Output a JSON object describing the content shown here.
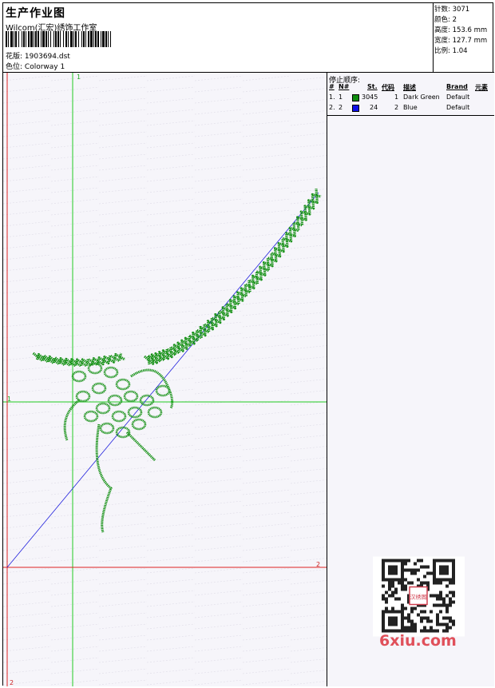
{
  "header": {
    "title": "生产作业图",
    "company": "Wilcom(汇宏)绣饰工作室",
    "design": {
      "label": "花版:",
      "value": "1903694.dst"
    },
    "colorway": {
      "label": "色位:",
      "value": "Colorway 1"
    }
  },
  "stats": [
    {
      "label": "针数:",
      "value": "3071"
    },
    {
      "label": "颜色:",
      "value": "2"
    },
    {
      "label": "高度:",
      "value": "153.6 mm"
    },
    {
      "label": "宽度:",
      "value": "127.7 mm"
    },
    {
      "label": "比例:",
      "value": "1.04"
    }
  ],
  "stop_sequence": {
    "title": "停止顺序:",
    "headers": {
      "hash": "#",
      "n": "N#",
      "st": "St.",
      "code": "代码",
      "desc": "描述",
      "brand": "Brand",
      "elements": "元素"
    },
    "rows": [
      {
        "hash": "1.",
        "n": "1",
        "color": "#0f8c0f",
        "st": "3045",
        "code": "1",
        "desc": "Dark Green",
        "brand": "Default"
      },
      {
        "hash": "2.",
        "n": "2",
        "color": "#1010e8",
        "st": "24",
        "code": "2",
        "desc": "Blue",
        "brand": "Default"
      }
    ]
  },
  "guides": {
    "top_label": "1",
    "left_label": "1",
    "right_label": "2",
    "bottom_label": "2"
  },
  "watermark": {
    "text": "6xiu.com",
    "stamp": "汉绣图"
  },
  "colors": {
    "guide_green": "#22cc22",
    "guide_red": "#dd2222",
    "stitch_green": "#149014",
    "stitch_blue": "#2020dd"
  }
}
